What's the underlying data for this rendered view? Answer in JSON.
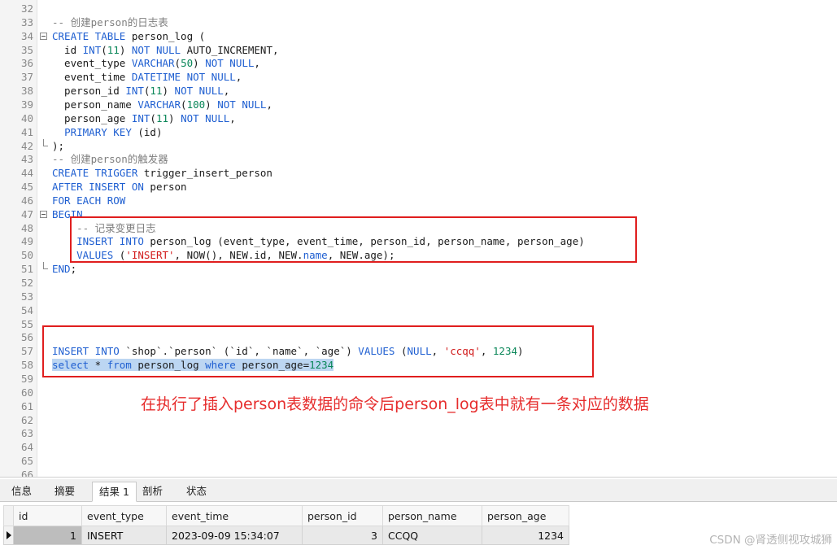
{
  "editor": {
    "lines": [
      {
        "n": "32",
        "fold": "",
        "html": ""
      },
      {
        "n": "33",
        "fold": "",
        "html": "<span class='cm'>-- 创建person的日志表</span>"
      },
      {
        "n": "34",
        "fold": "open",
        "html": "<span class='kw'>CREATE TABLE</span> person_log ("
      },
      {
        "n": "35",
        "fold": "",
        "html": "  id <span class='kw'>INT</span>(<span class='num'>11</span>) <span class='kw'>NOT NULL</span> AUTO_INCREMENT,"
      },
      {
        "n": "36",
        "fold": "",
        "html": "  event_type <span class='kw'>VARCHAR</span>(<span class='num'>50</span>) <span class='kw'>NOT NULL</span>,"
      },
      {
        "n": "37",
        "fold": "",
        "html": "  event_time <span class='kw'>DATETIME NOT NULL</span>,"
      },
      {
        "n": "38",
        "fold": "",
        "html": "  person_id <span class='kw'>INT</span>(<span class='num'>11</span>) <span class='kw'>NOT NULL</span>,"
      },
      {
        "n": "39",
        "fold": "",
        "html": "  person_name <span class='kw'>VARCHAR</span>(<span class='num'>100</span>) <span class='kw'>NOT NULL</span>,"
      },
      {
        "n": "40",
        "fold": "",
        "html": "  person_age <span class='kw'>INT</span>(<span class='num'>11</span>) <span class='kw'>NOT NULL</span>,"
      },
      {
        "n": "41",
        "fold": "",
        "html": "  <span class='kw'>PRIMARY KEY</span> (id)"
      },
      {
        "n": "42",
        "fold": "end",
        "html": ");"
      },
      {
        "n": "43",
        "fold": "",
        "html": "<span class='cm'>-- 创建person的触发器</span>"
      },
      {
        "n": "44",
        "fold": "",
        "html": "<span class='kw'>CREATE TRIGGER</span> trigger_insert_person"
      },
      {
        "n": "45",
        "fold": "",
        "html": "<span class='kw'>AFTER INSERT ON</span> person"
      },
      {
        "n": "46",
        "fold": "",
        "html": "<span class='kw'>FOR EACH ROW</span>"
      },
      {
        "n": "47",
        "fold": "open",
        "html": "<span class='kw'>BEGIN</span>"
      },
      {
        "n": "48",
        "fold": "",
        "html": "    <span class='cm'>-- 记录变更日志</span>"
      },
      {
        "n": "49",
        "fold": "",
        "html": "    <span class='kw'>INSERT INTO</span> person_log (event_type, event_time, person_id, person_name, person_age)"
      },
      {
        "n": "50",
        "fold": "",
        "html": "    <span class='kw'>VALUES</span> (<span class='str'>'INSERT'</span>, NOW(), NEW.id, NEW.<span class='kw'>name</span>, NEW.age);"
      },
      {
        "n": "51",
        "fold": "end",
        "html": "<span class='kw'>END</span>;"
      },
      {
        "n": "52",
        "fold": "",
        "html": ""
      },
      {
        "n": "53",
        "fold": "",
        "html": ""
      },
      {
        "n": "54",
        "fold": "",
        "html": ""
      },
      {
        "n": "55",
        "fold": "",
        "html": ""
      },
      {
        "n": "56",
        "fold": "",
        "html": ""
      },
      {
        "n": "57",
        "fold": "",
        "html": "<span class='kw'>INSERT INTO</span> `shop`.`person` (`id`, `name`, `age`) <span class='kw'>VALUES</span> (<span class='kw'>NULL</span>, <span class='str'>'ccqq'</span>, <span class='num'>1234</span>)"
      },
      {
        "n": "58",
        "fold": "",
        "html": "<span class='sel'><span class='kw'>select</span> * <span class='kw'>from</span> person_log <span class='kw'>where</span> person_age=<span class='num'>1234</span></span>"
      },
      {
        "n": "59",
        "fold": "",
        "html": ""
      },
      {
        "n": "60",
        "fold": "",
        "html": ""
      },
      {
        "n": "61",
        "fold": "",
        "html": ""
      },
      {
        "n": "62",
        "fold": "",
        "html": ""
      },
      {
        "n": "63",
        "fold": "",
        "html": ""
      },
      {
        "n": "64",
        "fold": "",
        "html": ""
      },
      {
        "n": "65",
        "fold": "",
        "html": ""
      },
      {
        "n": "66",
        "fold": "",
        "html": ""
      }
    ],
    "annotation": "在执行了插入person表数据的命令后person_log表中就有一条对应的数据"
  },
  "panel": {
    "tabs": [
      "信息",
      "摘要",
      "结果 1",
      "剖析",
      "状态"
    ],
    "active_tab": 2,
    "columns": [
      "id",
      "event_type",
      "event_time",
      "person_id",
      "person_name",
      "person_age"
    ],
    "rows": [
      {
        "id": "1",
        "event_type": "INSERT",
        "event_time": "2023-09-09 15:34:07",
        "person_id": "3",
        "person_name": "CCQQ",
        "person_age": "1234"
      }
    ]
  },
  "watermark": "CSDN @肾透侧视攻城狮",
  "colors": {
    "keyword": "#1f5fd1",
    "number": "#098658",
    "string": "#d11a1a",
    "comment": "#7f7f7f",
    "annotation": "#e62c2c",
    "box": "#e01e1e"
  }
}
